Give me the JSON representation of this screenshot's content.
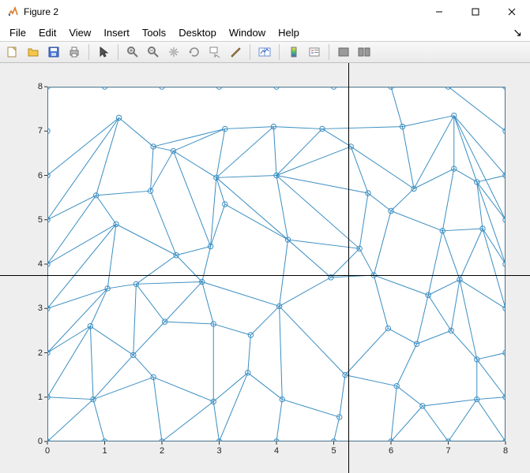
{
  "window": {
    "title": "Figure 2"
  },
  "menu": {
    "items": [
      "File",
      "Edit",
      "View",
      "Insert",
      "Tools",
      "Desktop",
      "Window",
      "Help"
    ]
  },
  "toolbar": {
    "buttons": [
      {
        "name": "new-figure-icon",
        "title": "New Figure"
      },
      {
        "name": "open-icon",
        "title": "Open"
      },
      {
        "name": "save-icon",
        "title": "Save"
      },
      {
        "name": "print-icon",
        "title": "Print"
      },
      {
        "sep": true
      },
      {
        "name": "pointer-icon",
        "title": "Edit Plot"
      },
      {
        "sep": true
      },
      {
        "name": "zoom-in-icon",
        "title": "Zoom In"
      },
      {
        "name": "zoom-out-icon",
        "title": "Zoom Out"
      },
      {
        "name": "pan-icon",
        "title": "Pan"
      },
      {
        "name": "rotate-icon",
        "title": "Rotate 3D"
      },
      {
        "name": "data-cursor-icon",
        "title": "Data Cursor"
      },
      {
        "name": "brush-icon",
        "title": "Brush"
      },
      {
        "sep": true
      },
      {
        "name": "link-plot-icon",
        "title": "Link Plot"
      },
      {
        "sep": true
      },
      {
        "name": "colorbar-icon",
        "title": "Insert Colorbar"
      },
      {
        "name": "legend-icon",
        "title": "Insert Legend"
      },
      {
        "sep": true
      },
      {
        "name": "hide-tools-icon",
        "title": "Hide Plot Tools"
      },
      {
        "name": "show-tools-icon",
        "title": "Show Plot Tools"
      }
    ]
  },
  "chart_data": {
    "type": "scatter",
    "xlim": [
      0,
      8
    ],
    "ylim": [
      0,
      8
    ],
    "xticks": [
      0,
      1,
      2,
      3,
      4,
      5,
      6,
      7,
      8
    ],
    "yticks": [
      0,
      1,
      2,
      3,
      4,
      5,
      6,
      7,
      8
    ],
    "crosshair": {
      "x": 5.25,
      "y": 3.75
    },
    "color": "#3b8ec2",
    "nodes": [
      [
        0,
        0
      ],
      [
        1,
        0
      ],
      [
        2,
        0
      ],
      [
        3,
        0
      ],
      [
        4,
        0
      ],
      [
        5,
        0
      ],
      [
        6,
        0
      ],
      [
        7,
        0
      ],
      [
        8,
        0
      ],
      [
        0,
        1
      ],
      [
        0,
        2
      ],
      [
        0,
        3
      ],
      [
        0,
        4
      ],
      [
        0,
        5
      ],
      [
        0,
        6
      ],
      [
        0,
        7
      ],
      [
        0,
        8
      ],
      [
        8,
        1
      ],
      [
        8,
        2
      ],
      [
        8,
        3
      ],
      [
        8,
        4
      ],
      [
        8,
        5
      ],
      [
        8,
        6
      ],
      [
        8,
        7
      ],
      [
        8,
        8
      ],
      [
        1,
        8
      ],
      [
        2,
        8
      ],
      [
        3,
        8
      ],
      [
        4,
        8
      ],
      [
        5,
        8
      ],
      [
        6,
        8
      ],
      [
        7,
        8
      ],
      [
        0.8,
        0.95
      ],
      [
        1.85,
        1.45
      ],
      [
        2.9,
        0.9
      ],
      [
        3.5,
        1.55
      ],
      [
        4.1,
        0.95
      ],
      [
        5.1,
        0.55
      ],
      [
        5.2,
        1.5
      ],
      [
        6.1,
        1.25
      ],
      [
        6.55,
        0.8
      ],
      [
        7.5,
        0.95
      ],
      [
        0.75,
        2.6
      ],
      [
        1.5,
        1.95
      ],
      [
        2.05,
        2.7
      ],
      [
        2.9,
        2.65
      ],
      [
        3.55,
        2.4
      ],
      [
        4.05,
        3.05
      ],
      [
        5.95,
        2.55
      ],
      [
        6.45,
        2.2
      ],
      [
        7.05,
        2.5
      ],
      [
        7.5,
        1.85
      ],
      [
        1.05,
        3.45
      ],
      [
        1.55,
        3.55
      ],
      [
        2.7,
        3.6
      ],
      [
        4.95,
        3.7
      ],
      [
        5.7,
        3.75
      ],
      [
        6.65,
        3.3
      ],
      [
        7.2,
        3.65
      ],
      [
        1.2,
        4.9
      ],
      [
        2.25,
        4.2
      ],
      [
        2.85,
        4.4
      ],
      [
        3.1,
        5.35
      ],
      [
        4.2,
        4.55
      ],
      [
        5.45,
        4.35
      ],
      [
        5.6,
        5.6
      ],
      [
        6.0,
        5.2
      ],
      [
        6.9,
        4.75
      ],
      [
        7.6,
        4.8
      ],
      [
        0.85,
        5.55
      ],
      [
        1.8,
        5.65
      ],
      [
        2.2,
        6.55
      ],
      [
        2.95,
        5.95
      ],
      [
        4.0,
        6.0
      ],
      [
        5.3,
        6.65
      ],
      [
        6.4,
        5.7
      ],
      [
        7.1,
        6.15
      ],
      [
        7.5,
        5.85
      ],
      [
        1.25,
        7.3
      ],
      [
        1.85,
        6.65
      ],
      [
        3.1,
        7.05
      ],
      [
        3.95,
        7.1
      ],
      [
        4.8,
        7.05
      ],
      [
        6.2,
        7.1
      ],
      [
        7.1,
        7.35
      ]
    ],
    "edges": [
      [
        0,
        1
      ],
      [
        1,
        2
      ],
      [
        2,
        3
      ],
      [
        3,
        4
      ],
      [
        4,
        5
      ],
      [
        5,
        6
      ],
      [
        6,
        7
      ],
      [
        7,
        8
      ],
      [
        0,
        9
      ],
      [
        9,
        10
      ],
      [
        10,
        11
      ],
      [
        11,
        12
      ],
      [
        12,
        13
      ],
      [
        13,
        14
      ],
      [
        14,
        15
      ],
      [
        15,
        16
      ],
      [
        8,
        17
      ],
      [
        17,
        18
      ],
      [
        18,
        19
      ],
      [
        19,
        20
      ],
      [
        20,
        21
      ],
      [
        21,
        22
      ],
      [
        22,
        23
      ],
      [
        23,
        24
      ],
      [
        16,
        25
      ],
      [
        25,
        26
      ],
      [
        26,
        27
      ],
      [
        27,
        28
      ],
      [
        28,
        29
      ],
      [
        29,
        30
      ],
      [
        30,
        31
      ],
      [
        31,
        24
      ],
      [
        0,
        32
      ],
      [
        1,
        32
      ],
      [
        9,
        32
      ],
      [
        32,
        33
      ],
      [
        2,
        33
      ],
      [
        33,
        43
      ],
      [
        33,
        34
      ],
      [
        2,
        34
      ],
      [
        3,
        34
      ],
      [
        34,
        35
      ],
      [
        3,
        35
      ],
      [
        35,
        36
      ],
      [
        4,
        36
      ],
      [
        36,
        37
      ],
      [
        5,
        37
      ],
      [
        37,
        38
      ],
      [
        38,
        39
      ],
      [
        6,
        39
      ],
      [
        39,
        40
      ],
      [
        6,
        40
      ],
      [
        7,
        40
      ],
      [
        40,
        41
      ],
      [
        7,
        41
      ],
      [
        8,
        41
      ],
      [
        17,
        41
      ],
      [
        9,
        42
      ],
      [
        10,
        42
      ],
      [
        42,
        32
      ],
      [
        32,
        43
      ],
      [
        42,
        43
      ],
      [
        43,
        44
      ],
      [
        44,
        45
      ],
      [
        34,
        45
      ],
      [
        45,
        46
      ],
      [
        35,
        46
      ],
      [
        46,
        47
      ],
      [
        36,
        47
      ],
      [
        47,
        38
      ],
      [
        38,
        48
      ],
      [
        48,
        49
      ],
      [
        39,
        49
      ],
      [
        49,
        50
      ],
      [
        50,
        51
      ],
      [
        41,
        51
      ],
      [
        51,
        17
      ],
      [
        51,
        18
      ],
      [
        10,
        52
      ],
      [
        11,
        52
      ],
      [
        42,
        52
      ],
      [
        52,
        53
      ],
      [
        43,
        53
      ],
      [
        44,
        53
      ],
      [
        53,
        54
      ],
      [
        44,
        54
      ],
      [
        45,
        54
      ],
      [
        54,
        47
      ],
      [
        47,
        55
      ],
      [
        55,
        56
      ],
      [
        48,
        56
      ],
      [
        56,
        57
      ],
      [
        49,
        57
      ],
      [
        50,
        57
      ],
      [
        57,
        58
      ],
      [
        50,
        58
      ],
      [
        58,
        19
      ],
      [
        51,
        58
      ],
      [
        11,
        59
      ],
      [
        12,
        59
      ],
      [
        52,
        59
      ],
      [
        53,
        60
      ],
      [
        59,
        60
      ],
      [
        54,
        60
      ],
      [
        60,
        61
      ],
      [
        54,
        61
      ],
      [
        61,
        62
      ],
      [
        62,
        63
      ],
      [
        47,
        63
      ],
      [
        55,
        63
      ],
      [
        63,
        64
      ],
      [
        55,
        64
      ],
      [
        56,
        64
      ],
      [
        64,
        65
      ],
      [
        65,
        66
      ],
      [
        56,
        66
      ],
      [
        66,
        67
      ],
      [
        57,
        67
      ],
      [
        58,
        67
      ],
      [
        67,
        68
      ],
      [
        58,
        68
      ],
      [
        68,
        20
      ],
      [
        19,
        68
      ],
      [
        12,
        69
      ],
      [
        13,
        69
      ],
      [
        59,
        69
      ],
      [
        69,
        70
      ],
      [
        60,
        70
      ],
      [
        70,
        71
      ],
      [
        61,
        71
      ],
      [
        71,
        72
      ],
      [
        61,
        72
      ],
      [
        62,
        72
      ],
      [
        63,
        72
      ],
      [
        72,
        73
      ],
      [
        63,
        73
      ],
      [
        65,
        73
      ],
      [
        64,
        73
      ],
      [
        65,
        74
      ],
      [
        73,
        74
      ],
      [
        74,
        75
      ],
      [
        66,
        75
      ],
      [
        75,
        76
      ],
      [
        67,
        76
      ],
      [
        76,
        77
      ],
      [
        68,
        77
      ],
      [
        77,
        21
      ],
      [
        20,
        77
      ],
      [
        13,
        78
      ],
      [
        14,
        78
      ],
      [
        69,
        78
      ],
      [
        78,
        79
      ],
      [
        70,
        79
      ],
      [
        71,
        79
      ],
      [
        79,
        80
      ],
      [
        71,
        80
      ],
      [
        72,
        80
      ],
      [
        80,
        81
      ],
      [
        72,
        81
      ],
      [
        73,
        81
      ],
      [
        81,
        82
      ],
      [
        73,
        82
      ],
      [
        74,
        82
      ],
      [
        82,
        83
      ],
      [
        75,
        83
      ],
      [
        83,
        84
      ],
      [
        75,
        84
      ],
      [
        76,
        84
      ],
      [
        84,
        22
      ],
      [
        77,
        84
      ],
      [
        77,
        22
      ],
      [
        21,
        84
      ],
      [
        14,
        85
      ],
      [
        15,
        85
      ],
      [
        78,
        85
      ],
      [
        85,
        86
      ],
      [
        79,
        86
      ],
      [
        86,
        87
      ],
      [
        80,
        87
      ],
      [
        87,
        88
      ],
      [
        81,
        88
      ],
      [
        88,
        89
      ],
      [
        82,
        89
      ],
      [
        89,
        83
      ],
      [
        83,
        90
      ],
      [
        89,
        90
      ],
      [
        90,
        91
      ],
      [
        84,
        91
      ],
      [
        91,
        23
      ],
      [
        22,
        91
      ],
      [
        15,
        16
      ],
      [
        16,
        25
      ],
      [
        85,
        25
      ],
      [
        25,
        86
      ],
      [
        86,
        26
      ],
      [
        26,
        87
      ],
      [
        87,
        27
      ],
      [
        27,
        88
      ],
      [
        28,
        88
      ],
      [
        28,
        89
      ],
      [
        89,
        29
      ],
      [
        29,
        90
      ],
      [
        30,
        90
      ],
      [
        30,
        83
      ],
      [
        30,
        91
      ],
      [
        31,
        91
      ],
      [
        31,
        23
      ]
    ]
  }
}
